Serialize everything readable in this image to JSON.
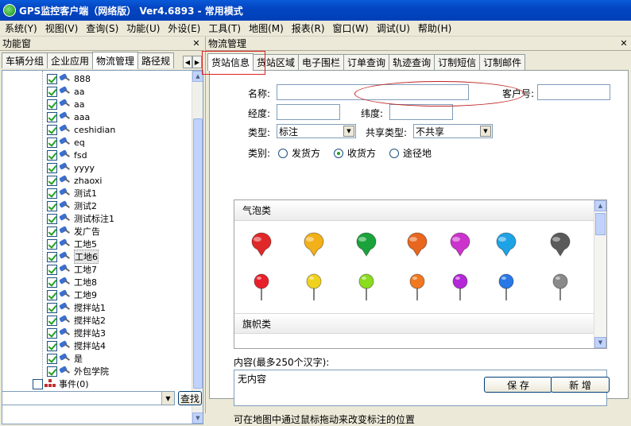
{
  "title": "GPS监控客户端（网络版） Ver4.6893 - 常用模式",
  "menu": [
    "系统(Y)",
    "视图(V)",
    "查询(S)",
    "功能(U)",
    "外设(E)",
    "工具(T)",
    "地图(M)",
    "报表(R)",
    "窗口(W)",
    "调试(U)",
    "帮助(H)"
  ],
  "left_pane": {
    "title": "功能窗",
    "tabs": [
      "车辆分组",
      "企业应用",
      "物流管理",
      "路径规"
    ],
    "active_tab": 2,
    "tree_items": [
      "888",
      "aa",
      "aa",
      "aaa",
      "ceshidian",
      "eq",
      "fsd",
      "yyyy",
      "zhaoxi",
      "测试1",
      "测试2",
      "测试标注1",
      "发广告",
      "工地5",
      "工地6",
      "工地7",
      "工地8",
      "工地9",
      "搅拌站1",
      "搅拌站2",
      "搅拌站3",
      "搅拌站4",
      "是",
      "外包学院"
    ],
    "selected_index": 14,
    "event_item": "事件(0)",
    "search_button": "查找"
  },
  "right_pane": {
    "title": "物流管理",
    "tabs": [
      "货站信息",
      "货站区域",
      "电子围栏",
      "订单查询",
      "轨迹查询",
      "订制短信",
      "订制邮件"
    ],
    "active_tab": 0,
    "form": {
      "name_label": "名称:",
      "customer_no_label": "客户号:",
      "lng_label": "经度:",
      "lat_label": "纬度:",
      "type_label": "类型:",
      "type_value": "标注",
      "share_type_label": "共享类型:",
      "share_type_value": "不共享",
      "category_label": "类别:",
      "category_options": [
        "发货方",
        "收货方",
        "途径地"
      ],
      "category_selected": 1
    },
    "icon_sections": [
      "气泡类",
      "旗帜类"
    ],
    "balloon_colors": [
      "#e02828",
      "#f2b019",
      "#19a33a",
      "#e8661e",
      "#cc33cc",
      "#1ea2e6",
      "#5a5a5a"
    ],
    "pin_colors": [
      "#e8202a",
      "#f0d21e",
      "#8adc1e",
      "#f07820",
      "#b428d8",
      "#2878e6",
      "#8a8a8a"
    ],
    "content_label": "内容(最多250个汉字):",
    "content_value": "无内容",
    "hint": "可在地图中通过鼠标拖动来改变标注的位置",
    "save_button": "保  存",
    "new_button": "新  增"
  }
}
